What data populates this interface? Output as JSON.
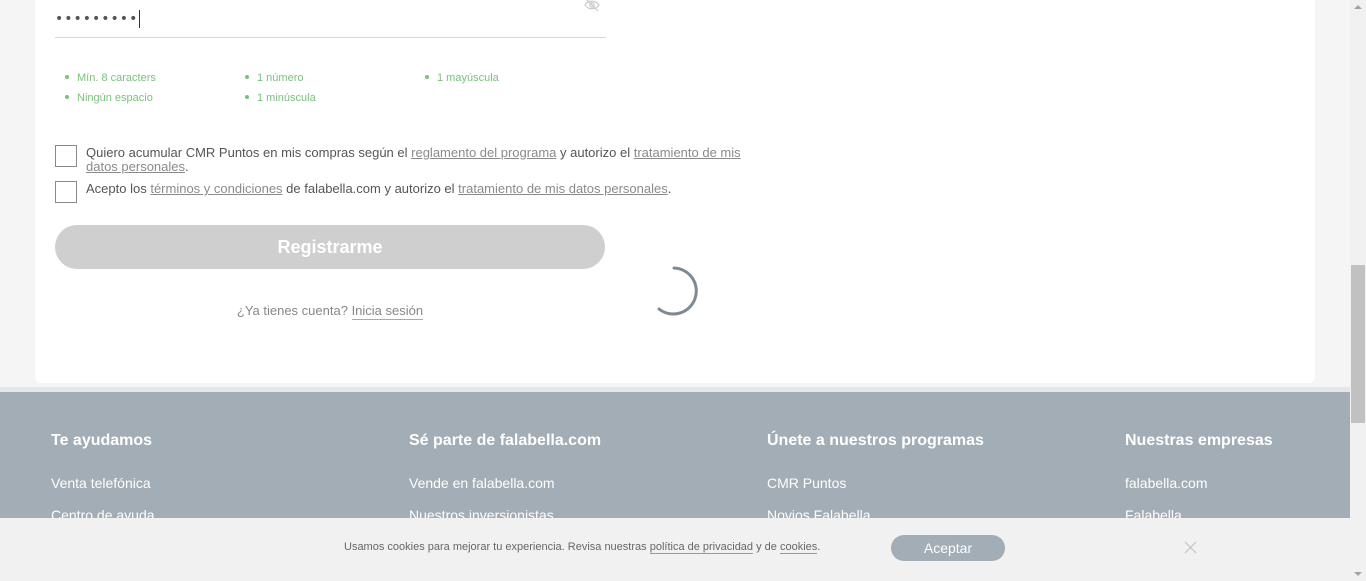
{
  "form": {
    "password_value": "•••••••••",
    "rules": [
      {
        "label": "Mín. 8 caracters"
      },
      {
        "label": "1 número"
      },
      {
        "label": "1 mayúscula"
      },
      {
        "label": "Ningún espacio"
      },
      {
        "label": "1 minúscula"
      }
    ],
    "cmr_consent": {
      "text_before": "Quiero acumular CMR Puntos en mis compras según el ",
      "link1": "reglamento del programa",
      "text_middle": "  y autorizo el ",
      "link2": "tratamiento de mis datos personales",
      "text_after": "."
    },
    "terms_consent": {
      "text_before": "Acepto los ",
      "link1": "términos y condiciones",
      "text_middle": " de falabella.com  y autorizo el ",
      "link2": "tratamiento de mis datos personales",
      "text_after": "."
    },
    "register_label": "Registrarme",
    "login_prompt": "¿Ya tienes cuenta?",
    "login_link": "Inicia sesión"
  },
  "footer": {
    "columns": [
      {
        "title": "Te ayudamos",
        "links": [
          "Venta telefónica",
          "Centro de ayuda"
        ]
      },
      {
        "title": "Sé parte de falabella.com",
        "links": [
          "Vende en falabella.com",
          "Nuestros inversionistas"
        ]
      },
      {
        "title": "Únete a nuestros programas",
        "links": [
          "CMR Puntos",
          "Novios Falabella"
        ]
      },
      {
        "title": "Nuestras empresas",
        "links": [
          "falabella.com",
          "Falabella"
        ]
      }
    ]
  },
  "cookies": {
    "text_before": "Usamos cookies para mejorar tu experiencia. Revisa nuestras ",
    "link1": "política de privacidad",
    "text_middle": " y de ",
    "link2": "cookies",
    "text_after": ".",
    "accept_label": "Aceptar"
  },
  "colors": {
    "rule_green": "#7ac27c",
    "footer_bg": "#a3adb5",
    "button_disabled": "#cfcfcf"
  },
  "icons": {
    "password_toggle": "eye-off-icon",
    "loading": "spinner-icon",
    "cookie_close": "close-icon"
  }
}
